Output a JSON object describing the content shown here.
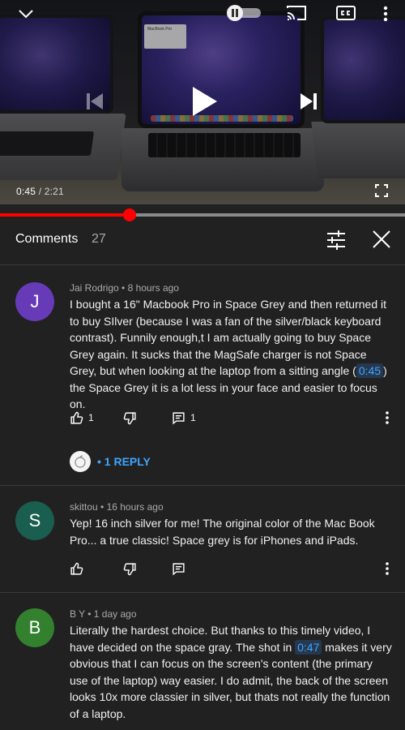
{
  "player": {
    "current_time": "0:45",
    "separator": " / ",
    "duration": "2:21",
    "progress_fraction": 0.32,
    "accent_color": "#ff0000",
    "icons": [
      "chevron-down-icon",
      "pause-icon",
      "cast-icon",
      "closed-captions-icon",
      "more-vert-icon",
      "skip-previous-icon",
      "play-icon",
      "skip-next-icon",
      "fullscreen-icon"
    ],
    "screen_window_text": "MacBook Pro"
  },
  "comments_panel": {
    "title": "Comments",
    "count": "27",
    "icons": [
      "filter-sort-icon",
      "close-icon"
    ]
  },
  "comments": [
    {
      "avatar_letter": "J",
      "avatar_color": "#673ab7",
      "author": "Jai Rodrigo",
      "age": "8 hours ago",
      "text_before": "I bought a 16\" Macbook Pro in Space Grey and then returned it to buy SIlver (because I was a fan of the silver/black keyboard contrast). Funnily enough,t I am actually going to buy Space Grey again. It sucks that the MagSafe charger is not Space Grey, but when looking at the laptop from a sitting angle (",
      "timestamp": "0:45",
      "text_after": ") the Space Grey it is a lot less in your face and easier to focus on.",
      "likes": "1",
      "replies_count": "1",
      "reply_link": "1 REPLY"
    },
    {
      "avatar_letter": "S",
      "avatar_color": "#1a5e4f",
      "author": "skittou",
      "age": "16 hours ago",
      "text": "Yep! 16 inch silver for me! The original color of the Mac Book Pro... a true classic! Space grey is for iPhones and iPads."
    },
    {
      "avatar_letter": "B",
      "avatar_color": "#33802e",
      "author": "B Y",
      "age": "1 day ago",
      "text_before": "Literally the hardest choice. But thanks to this timely video, I have decided on the space gray. The shot in ",
      "timestamp": "0:47",
      "text_after": " makes it very obvious that I can focus on the screen's content (the primary use of the laptop) way easier. I do admit, the back of the screen looks 10x more classier in silver, but thats not really the function of a laptop."
    }
  ]
}
